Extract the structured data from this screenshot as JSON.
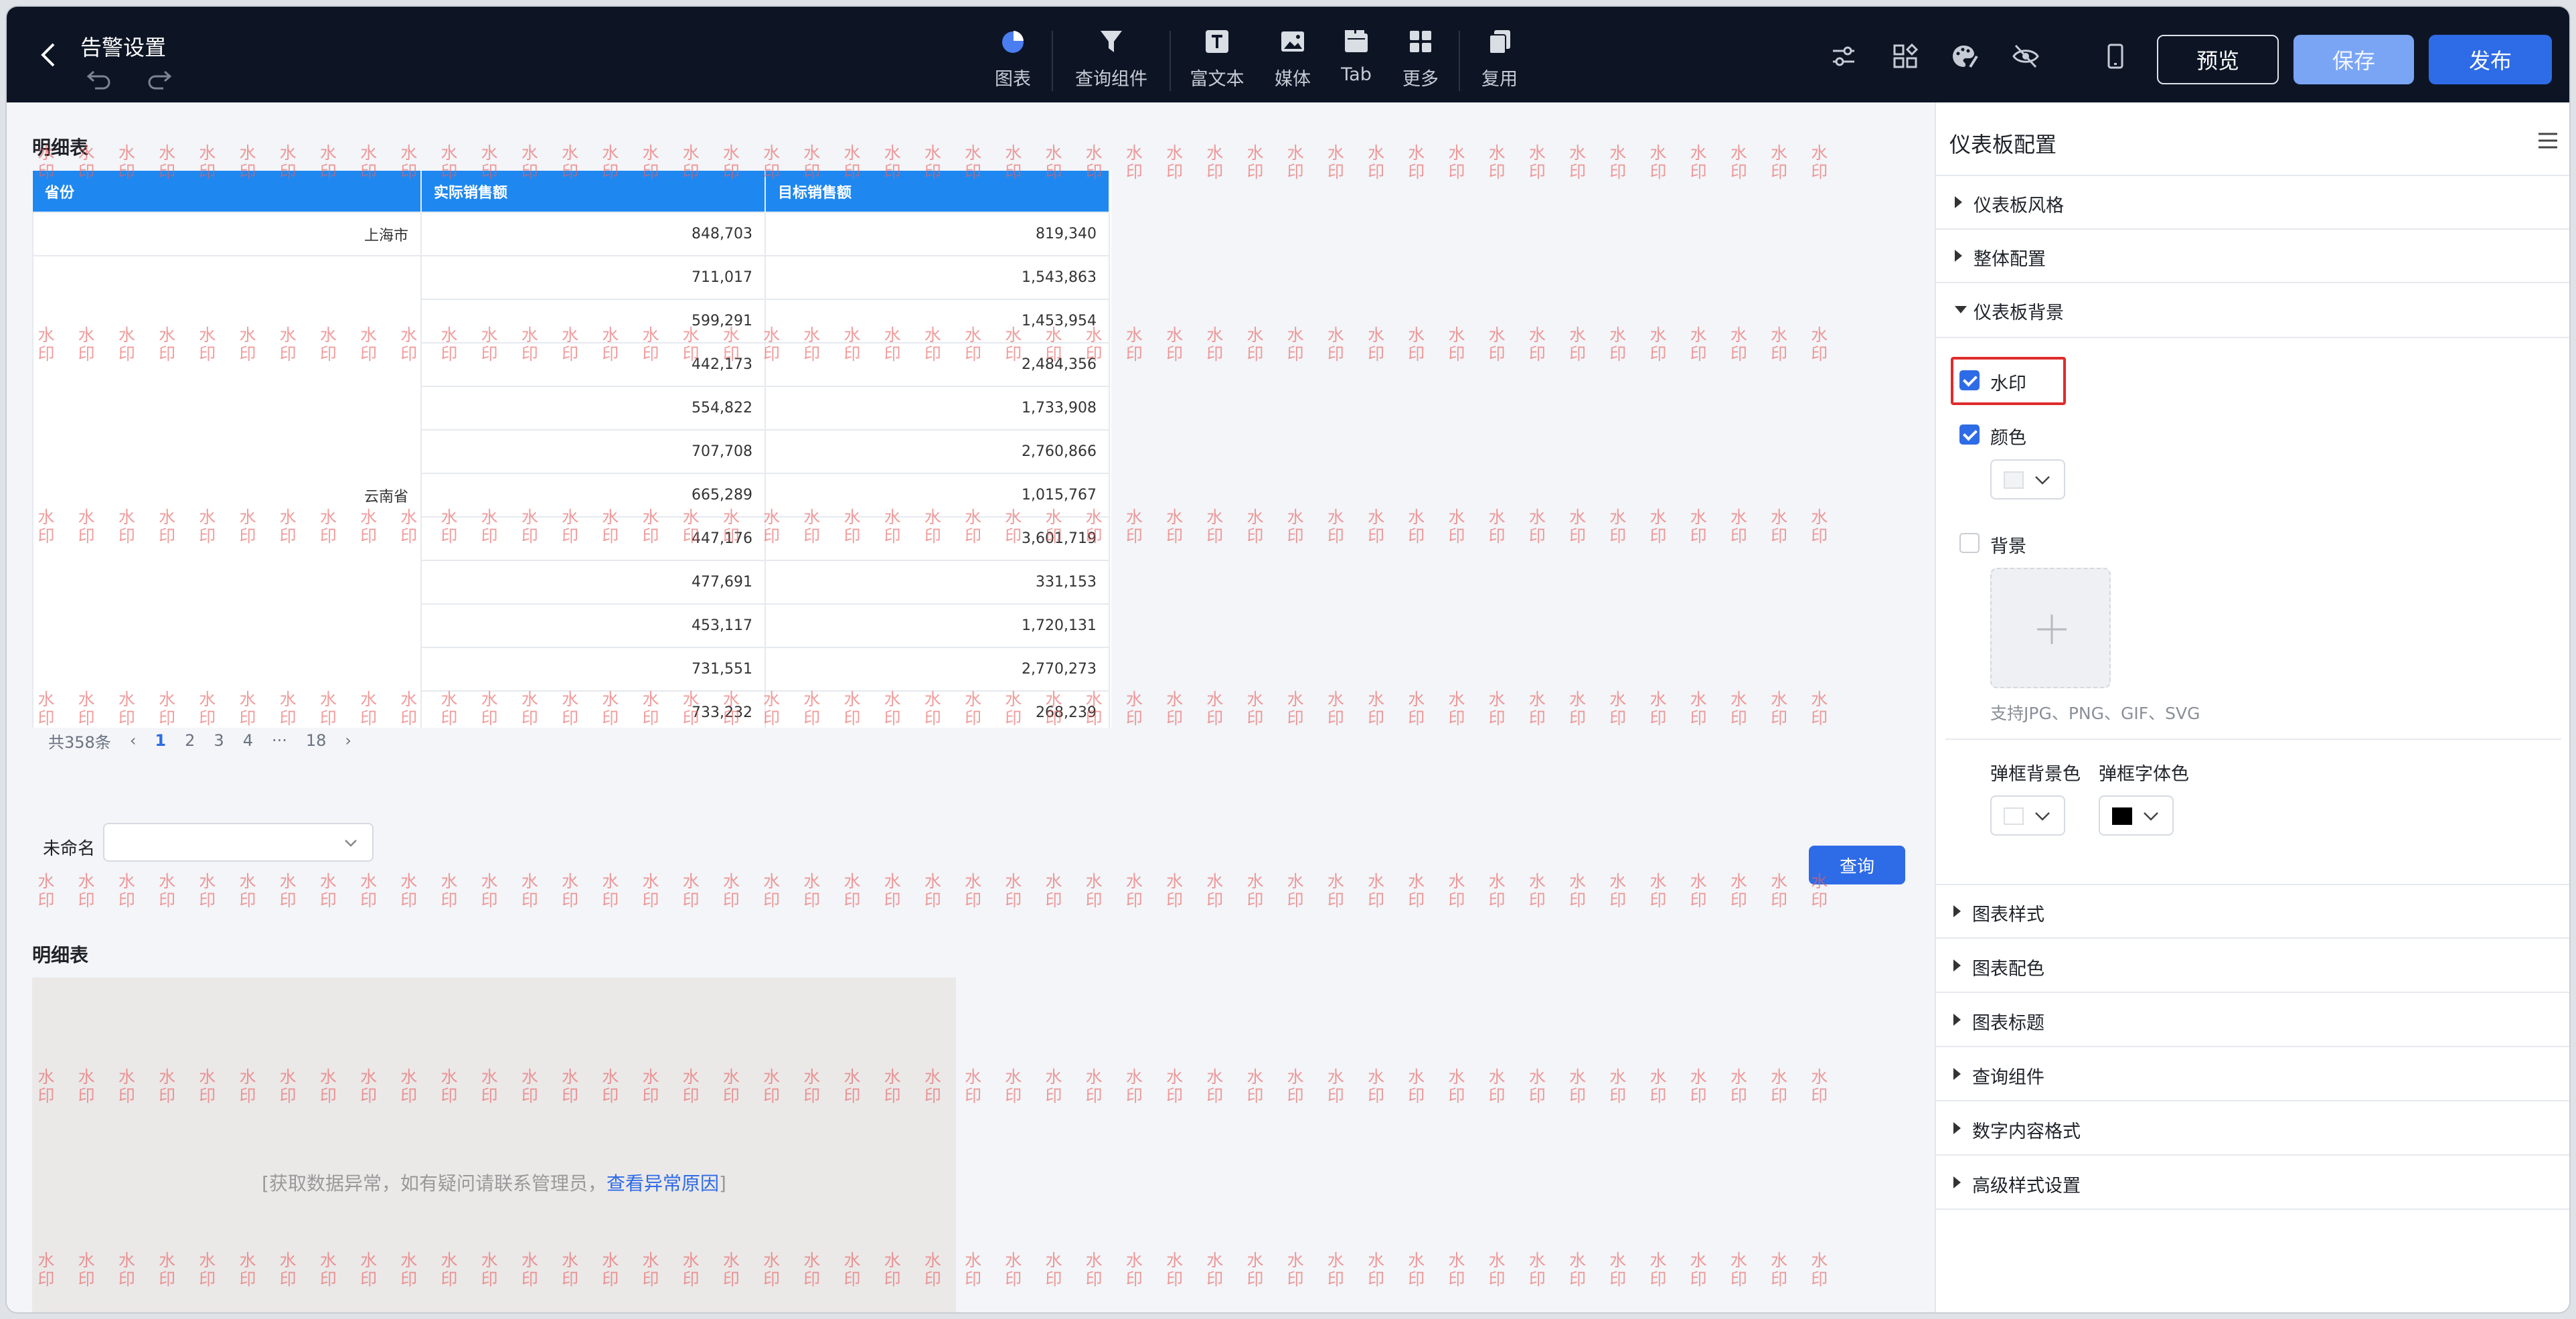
{
  "header": {
    "title": "告警设置",
    "tools": [
      {
        "label": "图表",
        "icon": "pie-chart-icon"
      },
      {
        "label": "查询组件",
        "icon": "filter-icon"
      },
      {
        "label": "富文本",
        "icon": "rich-text-icon"
      },
      {
        "label": "媒体",
        "icon": "image-icon"
      },
      {
        "label": "Tab",
        "icon": "tab-icon"
      },
      {
        "label": "更多",
        "icon": "grid-icon"
      },
      {
        "label": "复用",
        "icon": "copy-icon"
      }
    ],
    "preview_label": "预览",
    "save_label": "保存",
    "publish_label": "发布"
  },
  "table_card": {
    "title": "明细表",
    "columns": [
      "省份",
      "实际销售额",
      "目标销售额"
    ],
    "rows": [
      {
        "province": "上海市",
        "actual": "848,703",
        "target": "819,340"
      },
      {
        "province": "",
        "actual": "711,017",
        "target": "1,543,863"
      },
      {
        "province": "",
        "actual": "599,291",
        "target": "1,453,954"
      },
      {
        "province": "",
        "actual": "442,173",
        "target": "2,484,356"
      },
      {
        "province": "",
        "actual": "554,822",
        "target": "1,733,908"
      },
      {
        "province": "",
        "actual": "707,708",
        "target": "2,760,866"
      },
      {
        "province": "",
        "actual": "665,289",
        "target": "1,015,767"
      },
      {
        "province": "",
        "actual": "447,176",
        "target": "3,601,719"
      },
      {
        "province": "云南省",
        "actual": "477,691",
        "target": "331,153"
      },
      {
        "province": "",
        "actual": "453,117",
        "target": "1,720,131"
      },
      {
        "province": "",
        "actual": "731,551",
        "target": "2,770,273"
      },
      {
        "province": "",
        "actual": "733,232",
        "target": "268,239"
      }
    ],
    "pager": {
      "total": "共358条",
      "pages": [
        "1",
        "2",
        "3",
        "4",
        "···",
        "18"
      ],
      "current": "1"
    }
  },
  "filter": {
    "label": "未命名",
    "value": "",
    "query_label": "查询"
  },
  "second_card": {
    "title": "明细表",
    "error_prefix": "[获取数据异常，如有疑问请联系管理员，",
    "error_link": "查看异常原因",
    "error_suffix": "]"
  },
  "watermark": {
    "char1": "水",
    "char2": "印",
    "color": "#e85f5f"
  },
  "panel": {
    "title": "仪表板配置",
    "sections_top": [
      "仪表板风格",
      "整体配置",
      "仪表板背景"
    ],
    "watermark_label": "水印",
    "watermark_checked": true,
    "color_label": "颜色",
    "color_checked": true,
    "color_value": "#f2f3f5",
    "background_label": "背景",
    "background_checked": false,
    "upload_hint": "支持JPG、PNG、GIF、SVG",
    "popup_bg_label": "弹框背景色",
    "popup_bg_color": "#ffffff",
    "popup_font_label": "弹框字体色",
    "popup_font_color": "#000000",
    "sections_bottom": [
      "图表样式",
      "图表配色",
      "图表标题",
      "查询组件",
      "数字内容格式",
      "高级样式设置"
    ]
  },
  "colors": {
    "accent": "#2e6be6",
    "header_bg": "#0d1525",
    "table_header": "#1e88f0",
    "highlight": "#e02b2b"
  }
}
